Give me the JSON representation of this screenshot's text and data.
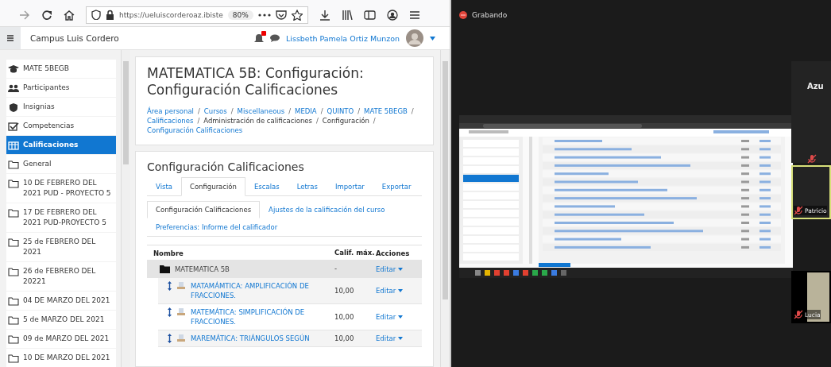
{
  "browser": {
    "url": "https://ueluiscorderoaz.ibiste",
    "zoom": "80%"
  },
  "site_header": {
    "site_name": "Campus Luis Cordero",
    "notifications": true,
    "user_name": "Lissbeth Pamela Ortiz Munzon"
  },
  "sidebar": {
    "items": [
      {
        "kind": "course",
        "label": "MATE 5BEGB",
        "selected": false
      },
      {
        "kind": "people",
        "label": "Participantes",
        "selected": false
      },
      {
        "kind": "badge",
        "label": "Insignias",
        "selected": false
      },
      {
        "kind": "check",
        "label": "Competencias",
        "selected": false
      },
      {
        "kind": "grades",
        "label": "Calificaciones",
        "selected": true
      },
      {
        "kind": "folder",
        "label": "General",
        "selected": false
      },
      {
        "kind": "folder",
        "label": "10 DE FEBRERO DEL 2021 PUD - PROYECTO 5",
        "selected": false
      },
      {
        "kind": "folder",
        "label": "17 DE FEBRERO DEL 2021 PUD-PROYECTO 5",
        "selected": false
      },
      {
        "kind": "folder",
        "label": "25 de FEBRERO DEL 2021",
        "selected": false
      },
      {
        "kind": "folder",
        "label": "26 de FEBRERO DEL 20221",
        "selected": false
      },
      {
        "kind": "folder",
        "label": "04 DE MARZO DEL 2021",
        "selected": false
      },
      {
        "kind": "folder",
        "label": "5 de MARZO DEL 2021",
        "selected": false
      },
      {
        "kind": "folder",
        "label": "09 de MARZO DEL 2021",
        "selected": false
      },
      {
        "kind": "folder",
        "label": "10 DE MARZO DEL 2021",
        "selected": false
      }
    ]
  },
  "page": {
    "title": "MATEMATICA 5B: Configuración: Configuración Calificaciones",
    "breadcrumb_separator": "/",
    "breadcrumb": [
      {
        "label": "Área personal",
        "link": true
      },
      {
        "label": "Cursos",
        "link": true
      },
      {
        "label": "Miscellaneous",
        "link": true
      },
      {
        "label": "MEDIA",
        "link": true
      },
      {
        "label": "QUINTO",
        "link": true
      },
      {
        "label": "MATE 5BEGB",
        "link": true
      },
      {
        "label": "Calificaciones",
        "link": true
      },
      {
        "label": "Administración de calificaciones",
        "link": false
      },
      {
        "label": "Configuración",
        "link": false
      },
      {
        "label": "Configuración Calificaciones",
        "link": true
      }
    ],
    "section_title": "Configuración Calificaciones",
    "tabs": [
      {
        "label": "Vista",
        "selected": false
      },
      {
        "label": "Configuración",
        "selected": true
      },
      {
        "label": "Escalas",
        "selected": false
      },
      {
        "label": "Letras",
        "selected": false
      },
      {
        "label": "Importar",
        "selected": false
      },
      {
        "label": "Exportar",
        "selected": false
      }
    ],
    "subtabs": [
      {
        "label": "Configuración Calificaciones",
        "selected": true
      },
      {
        "label": "Ajustes de la calificación del curso",
        "selected": false
      },
      {
        "label": "Preferencias: Informe del calificador",
        "selected": false
      }
    ],
    "table": {
      "columns": [
        "Nombre",
        "Calif. máx.",
        "Acciones"
      ],
      "rows": [
        {
          "kind": "category",
          "name": "MATEMATICA 5B",
          "max": "-",
          "action": "Editar"
        },
        {
          "kind": "item",
          "name": "MATAMÁMTICA: AMPLIFICACIÓN DE FRACCIONES.",
          "max": "10,00",
          "action": "Editar"
        },
        {
          "kind": "item",
          "name": "MATEMÁTICA: SIMPLIFICACIÓN DE FRACCIONES.",
          "max": "10,00",
          "action": "Editar"
        },
        {
          "kind": "item",
          "name": "MAREMÁTICA: TRIÁNGULOS SEGÚN",
          "max": "10,00",
          "action": "Editar"
        }
      ]
    }
  },
  "meeting": {
    "recording_label": "Grabando",
    "participants": [
      {
        "kind": "name",
        "name": "Azu",
        "muted": true,
        "speaking": false
      },
      {
        "kind": "name",
        "name": "Patricio",
        "muted": true,
        "speaking": true
      },
      {
        "kind": "video",
        "name": "Lucia",
        "muted": true,
        "speaking": false
      }
    ]
  }
}
